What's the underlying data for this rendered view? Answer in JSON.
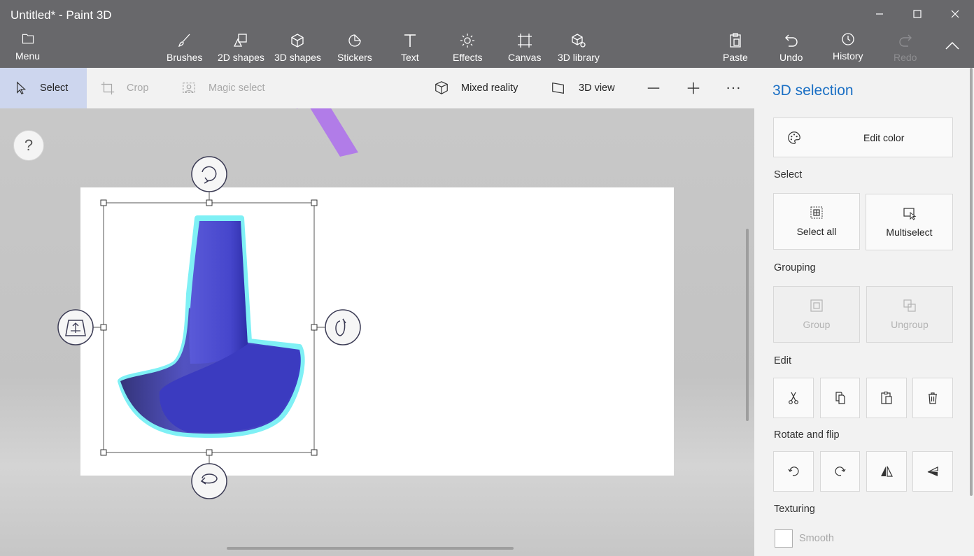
{
  "window": {
    "title": "Untitled* - Paint 3D"
  },
  "ribbon": {
    "menu_label": "Menu",
    "tools": [
      {
        "label": "Brushes",
        "icon": "brush-icon"
      },
      {
        "label": "2D shapes",
        "icon": "2d-shapes-icon"
      },
      {
        "label": "3D shapes",
        "icon": "cube-icon"
      },
      {
        "label": "Stickers",
        "icon": "sticker-icon"
      },
      {
        "label": "Text",
        "icon": "text-icon"
      },
      {
        "label": "Effects",
        "icon": "sun-icon"
      },
      {
        "label": "Canvas",
        "icon": "canvas-icon"
      },
      {
        "label": "3D library",
        "icon": "3d-library-icon"
      }
    ],
    "paste_label": "Paste",
    "undo_label": "Undo",
    "history_label": "History",
    "redo_label": "Redo"
  },
  "toolbar": {
    "select_label": "Select",
    "crop_label": "Crop",
    "magic_select_label": "Magic select",
    "mixed_reality_label": "Mixed reality",
    "view_3d_label": "3D view"
  },
  "canvas": {
    "help_label": "?"
  },
  "panel": {
    "title": "3D selection",
    "edit_color_label": "Edit color",
    "select_section": "Select",
    "select_all_label": "Select all",
    "multiselect_label": "Multiselect",
    "grouping_section": "Grouping",
    "group_label": "Group",
    "ungroup_label": "Ungroup",
    "edit_section": "Edit",
    "rotate_section": "Rotate and flip",
    "texturing_section": "Texturing",
    "smooth_label": "Smooth"
  },
  "colors": {
    "accent": "#1a6fc4",
    "annotation_arrow": "#b17ce8",
    "shape_blue": "#4444c8",
    "selection_glow": "#7ff0f5"
  }
}
